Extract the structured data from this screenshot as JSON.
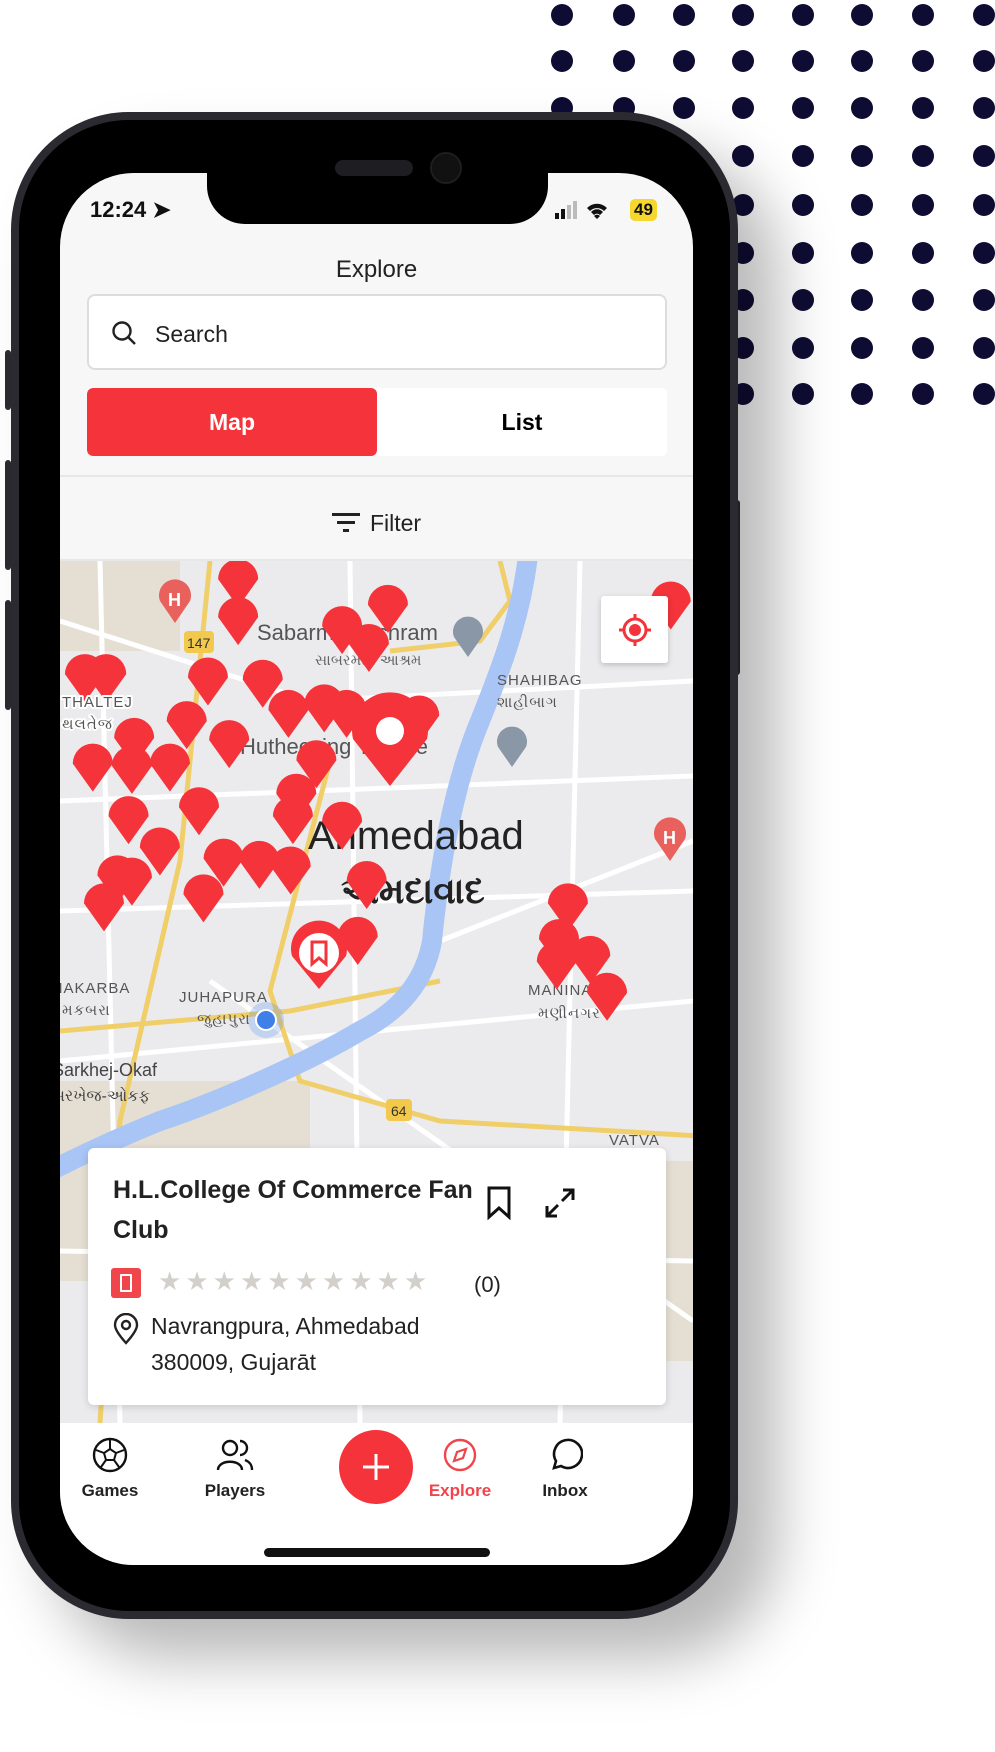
{
  "status": {
    "time": "12:24",
    "battery": "49"
  },
  "header": {
    "title": "Explore"
  },
  "search": {
    "placeholder": "Search"
  },
  "view_toggle": {
    "options": [
      "Map",
      "List"
    ],
    "selected": "Map"
  },
  "filter": {
    "label": "Filter"
  },
  "map": {
    "labels": {
      "sabarmati": "Sabarmati Ashram",
      "sabarmati_gu": "સાબરમતી આશ્રમ",
      "shahibag": "SHAHIBAG",
      "shahibag_gu": "શાહીબાગ",
      "hutheesing": "Hutheesing Temple",
      "city": "Ahmedabad",
      "city_gu": "અમદાવાદ",
      "thaltej": "THALTEJ",
      "thaltej_gu": "થલતેજ",
      "makarba": "MAKARBA",
      "makarba_gu": "મકબરા",
      "juhapura": "JUHAPURA",
      "juhapura_gu": "જુહાપુરા",
      "sarkhej": "Sarkhej-Okaf",
      "sarkhej_gu": "સરખેજ-ઓકફ",
      "maninagar": "MANINAGAR",
      "maninagar_gu": "મણીનગર",
      "vatva": "VATVA",
      "road_147": "147",
      "road_64": "64"
    },
    "pin_color": "#f4333a"
  },
  "card": {
    "title": "H.L.College Of Commerce Fan Club",
    "rating": 0,
    "max_rating": 10,
    "review_count": "(0)",
    "address_line1": "Navrangpura, Ahmedabad",
    "address_line2": "380009, Gujarāt"
  },
  "nav": {
    "items": [
      {
        "label": "Games",
        "icon": "soccer-ball-icon"
      },
      {
        "label": "Players",
        "icon": "users-icon"
      },
      {
        "label": "Explore",
        "icon": "compass-icon",
        "active": true
      },
      {
        "label": "Inbox",
        "icon": "chat-bubble-icon"
      }
    ],
    "add_icon": "plus-icon"
  },
  "colors": {
    "accent": "#f4333a",
    "dots": "#0f0c33"
  }
}
